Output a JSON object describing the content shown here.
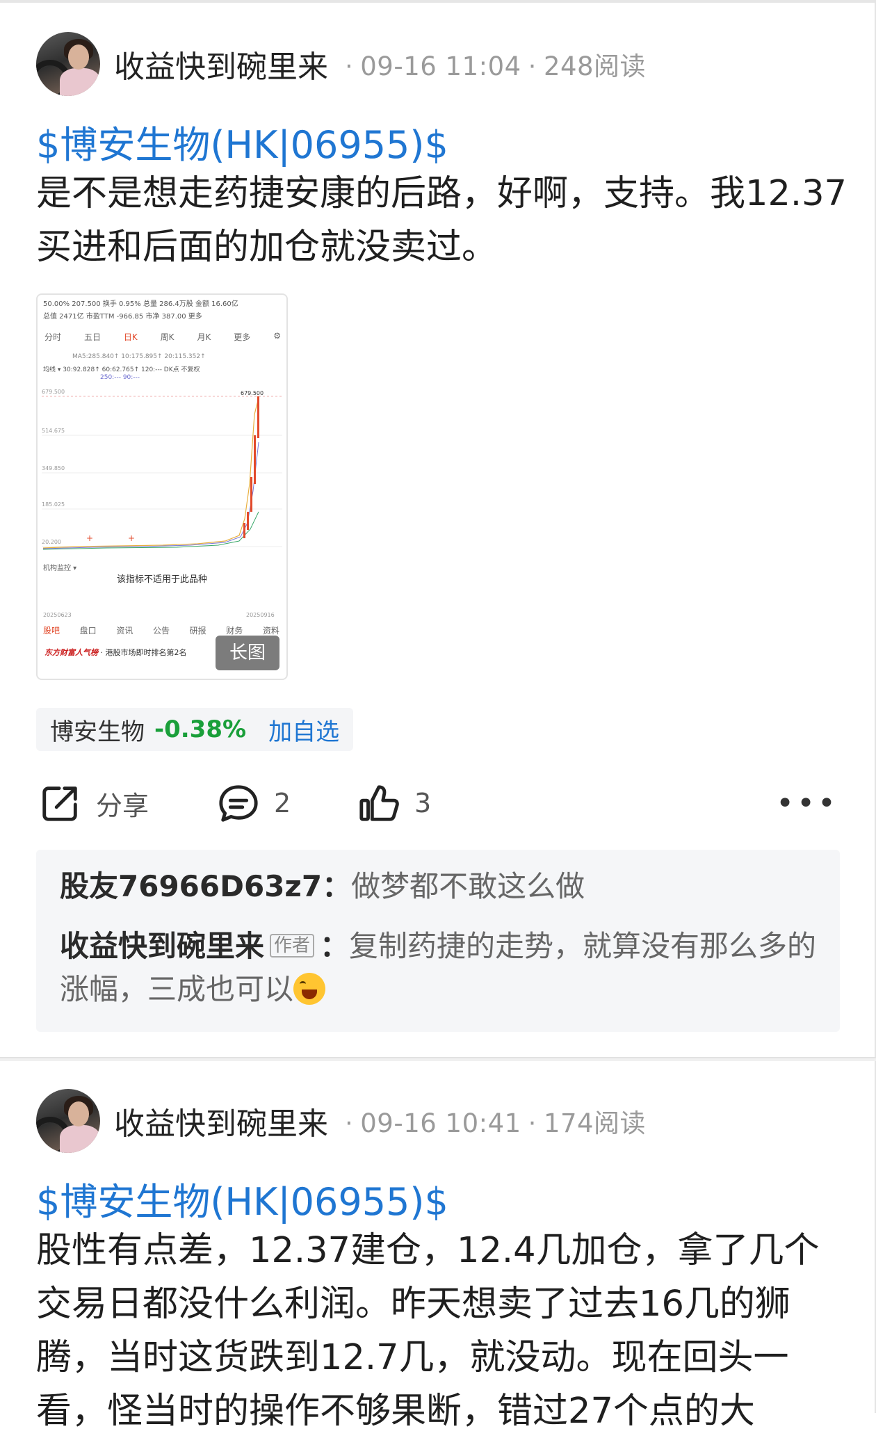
{
  "posts": [
    {
      "author": "收益快到碗里来",
      "time": "09-16 11:04",
      "reads": "248阅读",
      "stock_tag": "$博安生物(HK|06955)$",
      "text": "是不是想走药捷安康的后路，好啊，支持。我12.37买进和后面的加仓就没卖过。",
      "chart_thumb": {
        "row1": "50.00%  207.500   换手     0.95%   总量 286.4万股  金额     16.60亿",
        "row2": "总值    2471亿  市盈TTM -966.85  市净      387.00                 更多",
        "tabs": [
          "分时",
          "五日",
          "日K",
          "周K",
          "月K",
          "更多",
          "⚙"
        ],
        "row_ma": "MA5:285.840↑   10:175.895↑     20:115.352↑",
        "row_avg": "均线 ▾     30:92.828↑      60:62.765↑     120:---   DK点   不复权",
        "row_250": "250:---          90:---",
        "y_labels": [
          "679.500",
          "514.675",
          "349.850",
          "185.025",
          "20.200"
        ],
        "peak_label": "679.500",
        "monitor": "机构监控 ▾",
        "notice": "该指标不适用于此品种",
        "date_start": "20250623",
        "date_end": "20250916",
        "bottom_tabs": [
          "股吧",
          "盘口",
          "资讯",
          "公告",
          "研报",
          "财务",
          "资料"
        ],
        "brand": "东方财富人气榜",
        "brand_rest": "· 港股市场即时排名第2名",
        "long_badge": "长图"
      },
      "stock_pill": {
        "name": "博安生物",
        "change": "-0.38%",
        "add": "加自选"
      },
      "actions": {
        "share": "分享",
        "comments": "2",
        "likes": "3",
        "more": "•••"
      },
      "comments": [
        {
          "user": "股友76966D63z7",
          "sep": "：",
          "text": "做梦都不敢这么做"
        },
        {
          "user": "收益快到碗里来",
          "tag": "作者",
          "sep": "：",
          "text": "复制药捷的走势，就算没有那么多的涨幅，三成也可以"
        }
      ]
    },
    {
      "author": "收益快到碗里来",
      "time": "09-16 10:41",
      "reads": "174阅读",
      "stock_tag": "$博安生物(HK|06955)$",
      "text": "股性有点差，12.37建仓，12.4几加仓，拿了几个交易日都没什么利润。昨天想卖了过去16几的狮腾，当时这货跌到12.7几，就没动。现在回头一看，怪当时的操作不够果断，错过27个点的大"
    }
  ],
  "colors": {
    "link": "#1f76d2",
    "down": "#1a9f3a",
    "meta": "#9a9a9a"
  }
}
